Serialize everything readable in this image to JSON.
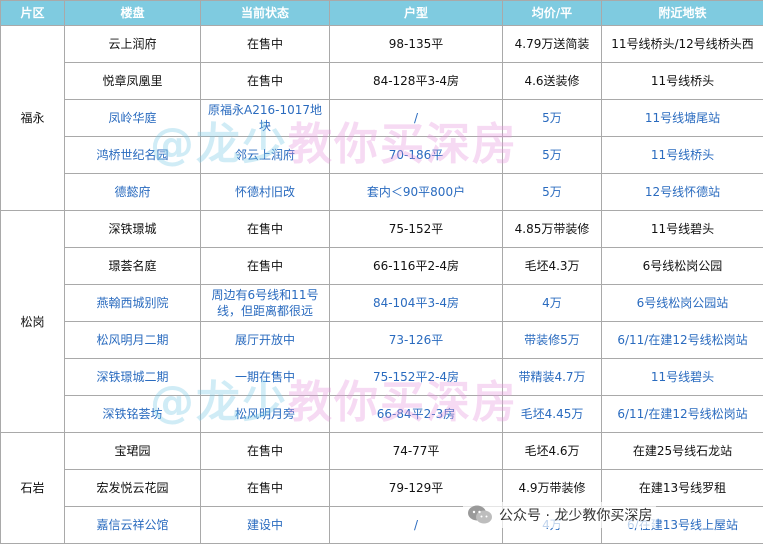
{
  "headers": [
    "片区",
    "楼盘",
    "当前状态",
    "户型",
    "均价/平",
    "附近地铁"
  ],
  "groups": [
    {
      "district": "福永",
      "rows": [
        {
          "style": "black",
          "cells": [
            "云上润府",
            "在售中",
            "98-135平",
            "4.79万送简装",
            "11号线桥头/12号线桥头西"
          ]
        },
        {
          "style": "black",
          "cells": [
            "悦章凤凰里",
            "在售中",
            "84-128平3-4房",
            "4.6送装修",
            "11号线桥头"
          ]
        },
        {
          "style": "blue",
          "cells": [
            "凤岭华庭",
            "原福永A216-1017地块",
            "/",
            "5万",
            "11号线塘尾站"
          ]
        },
        {
          "style": "blue",
          "cells": [
            "鸿桥世纪名园",
            "邻云上润府",
            "70-186平",
            "5万",
            "11号线桥头"
          ]
        },
        {
          "style": "blue",
          "cells": [
            "德懿府",
            "怀德村旧改",
            "套内＜90平800户",
            "5万",
            "12号线怀德站"
          ]
        }
      ]
    },
    {
      "district": "松岗",
      "rows": [
        {
          "style": "black",
          "cells": [
            "深铁璟城",
            "在售中",
            "75-152平",
            "4.85万带装修",
            "11号线碧头"
          ]
        },
        {
          "style": "black",
          "cells": [
            "璟荟名庭",
            "在售中",
            "66-116平2-4房",
            "毛坯4.3万",
            "6号线松岗公园"
          ]
        },
        {
          "style": "blue",
          "cells": [
            "燕翰西城别院",
            "周边有6号线和11号线，但距离都很远",
            "84-104平3-4房",
            "4万",
            "6号线松岗公园站"
          ]
        },
        {
          "style": "blue",
          "cells": [
            "松风明月二期",
            "展厅开放中",
            "73-126平",
            "带装修5万",
            "6/11/在建12号线松岗站"
          ]
        },
        {
          "style": "blue",
          "cells": [
            "深铁璟城二期",
            "一期在售中",
            "75-152平2-4房",
            "带精装4.7万",
            "11号线碧头"
          ]
        },
        {
          "style": "blue",
          "cells": [
            "深铁铭荟坊",
            "松风明月旁",
            "66-84平2-3房",
            "毛坯4.45万",
            "6/11/在建12号线松岗站"
          ]
        }
      ]
    },
    {
      "district": "石岩",
      "rows": [
        {
          "style": "black",
          "cells": [
            "宝珺园",
            "在售中",
            "74-77平",
            "毛坯4.6万",
            "在建25号线石龙站"
          ]
        },
        {
          "style": "black",
          "cells": [
            "宏发悦云花园",
            "在售中",
            "79-129平",
            "4.9万带装修",
            "在建13号线罗租"
          ]
        },
        {
          "style": "blue",
          "cells": [
            "嘉信云祥公馆",
            "建设中",
            "/",
            "4万",
            "6/在建13号线上屋站"
          ]
        }
      ]
    }
  ],
  "watermarks": {
    "line1_a": "@龙少",
    "line1_b": "教你买深房",
    "line2_a": "@龙少",
    "line2_b": "教你买深房"
  },
  "wechat": {
    "icon": "wechat-official-account-icon",
    "label": "公众号 · 龙少教你买深房"
  },
  "colors": {
    "header_bg": "#7fcbe0",
    "highlight_text": "#2a6bbf",
    "normal_text": "#111111"
  }
}
